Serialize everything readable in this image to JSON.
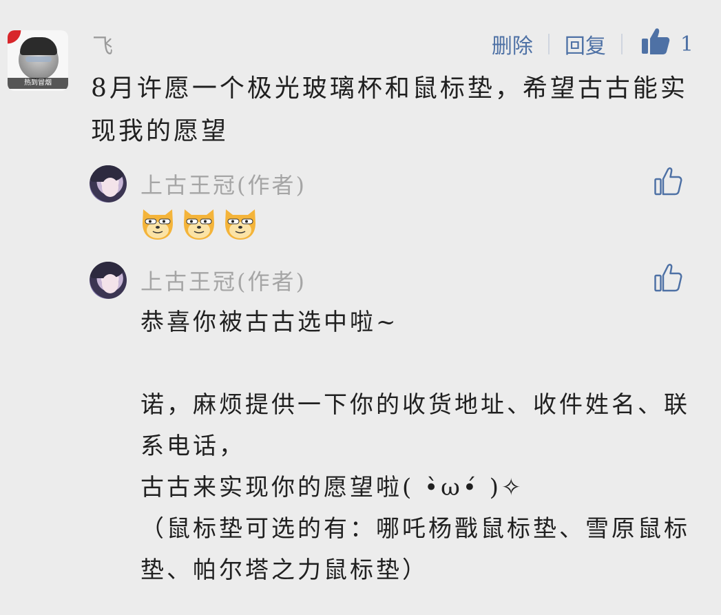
{
  "main_comment": {
    "username": "飞",
    "avatar_caption": "热到冒烟",
    "text": "8月许愿一个极光玻璃杯和鼠标垫，希望古古能实现我的愿望",
    "actions": {
      "delete_label": "删除",
      "reply_label": "回复",
      "like_count": "1"
    }
  },
  "replies": [
    {
      "author": "上古王冠(作者)",
      "content_type": "emoji",
      "emojis": [
        "doge-emoji",
        "doge-emoji",
        "doge-emoji"
      ]
    },
    {
      "author": "上古王冠(作者)",
      "content_type": "text",
      "text": "恭喜你被古古选中啦~\n\n诺，麻烦提供一下你的收货地址、收件姓名、联系电话，\n古古来实现你的愿望啦( •̀ω•́ )✧\n（鼠标垫可选的有：哪吒杨戬鼠标垫、雪原鼠标垫、帕尔塔之力鼠标垫）"
    }
  ],
  "colors": {
    "background": "#ececec",
    "accent": "#4e71a5",
    "username_gray": "#9a9a9a",
    "text": "#202020"
  }
}
